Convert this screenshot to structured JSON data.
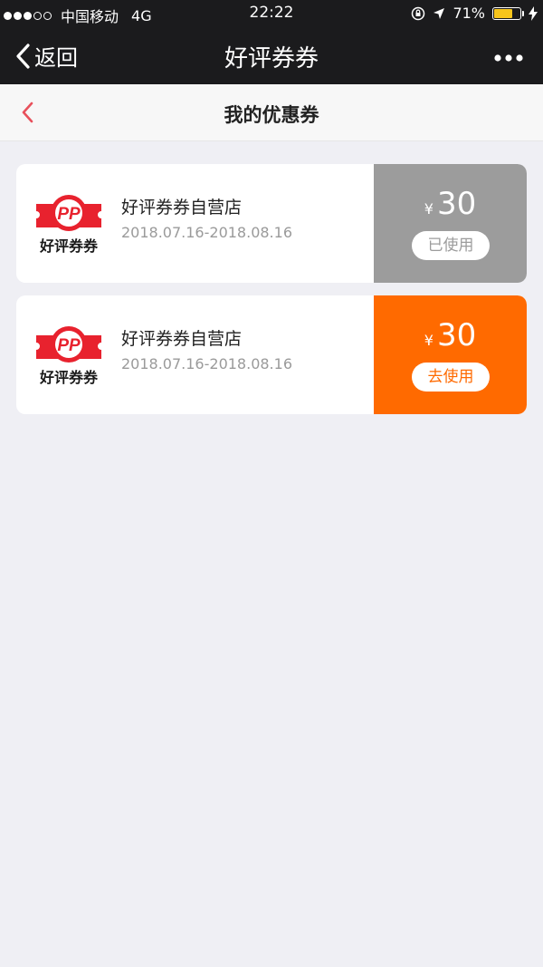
{
  "status_bar": {
    "carrier": "中国移动",
    "network": "4G",
    "time": "22:22",
    "battery": "71%",
    "battery_level": 0.71
  },
  "nav": {
    "back_label": "返回",
    "title": "好评券券"
  },
  "subheader": {
    "title": "我的优惠券"
  },
  "coupons": [
    {
      "store": "好评券券自营店",
      "date_range": "2018.07.16-2018.08.16",
      "currency": "¥",
      "amount": "30",
      "action": "已使用",
      "state": "used"
    },
    {
      "store": "好评券券自营店",
      "date_range": "2018.07.16-2018.08.16",
      "currency": "¥",
      "amount": "30",
      "action": "去使用",
      "state": "active"
    }
  ],
  "logo": {
    "text": "好评券券"
  },
  "colors": {
    "nav_bg": "#1b1b1d",
    "used_bg": "#9c9c9c",
    "active_bg": "#ff6a00",
    "brand_red": "#e8222e",
    "back_chevron": "#e8505b"
  },
  "icons": {
    "back": "chevron-left-icon",
    "more": "more-dots-icon",
    "lock": "rotation-lock-icon",
    "location": "location-arrow-icon",
    "charging": "lightning-icon"
  }
}
